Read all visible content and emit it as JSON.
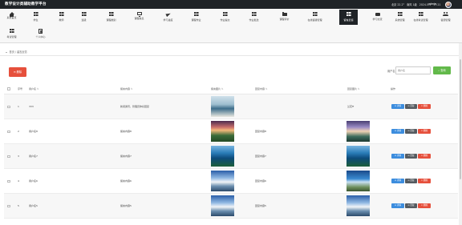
{
  "header": {
    "title": "教学设计类辅助教学平台",
    "date": "2024-5-1",
    "time": "17:21",
    "weather_a": "北京 22.2°",
    "weather_b": "南风 1级",
    "user": "admin"
  },
  "nav": {
    "items": [
      {
        "label": "系统首页",
        "icon": "home-icon"
      },
      {
        "label": "学生",
        "icon": "grid-icon"
      },
      {
        "label": "教师",
        "icon": "grid-icon"
      },
      {
        "label": "班级",
        "icon": "grid-icon"
      },
      {
        "label": "课程类别",
        "icon": "grid-icon"
      },
      {
        "label": "课程信息",
        "icon": "monitor-icon"
      },
      {
        "label": "学习进度",
        "icon": "plane-icon"
      },
      {
        "label": "课程作业",
        "icon": "grid-icon"
      },
      {
        "label": "作业提交",
        "icon": "grid-icon"
      },
      {
        "label": "作业批改",
        "icon": "grid-icon"
      },
      {
        "label": "课程评价",
        "icon": "folder-icon"
      },
      {
        "label": "在线答疑管理",
        "icon": "grid-icon"
      },
      {
        "label": "留言反馈",
        "icon": "grid-icon"
      },
      {
        "label": "学习交流",
        "icon": "chat-icon"
      },
      {
        "label": "系统管理",
        "icon": "grid-icon"
      },
      {
        "label": "在线考试管理",
        "icon": "grid-icon"
      },
      {
        "label": "答题管理",
        "icon": "users-icon"
      },
      {
        "label": "考试管理",
        "icon": "grid-icon"
      },
      {
        "label": "个人中心",
        "icon": "doc-icon"
      }
    ],
    "active_label": "留言反馈"
  },
  "breadcrumb": {
    "home": "首页",
    "sep": "/",
    "current": "留言反馈"
  },
  "toolbar": {
    "delete_label": "⊖ 删除",
    "search_label": "用户名",
    "search_placeholder": "用户名",
    "search_button": "⌕ 查询"
  },
  "table": {
    "columns": [
      "序号",
      "用户名",
      "留言内容",
      "留言图片",
      "回复内容",
      "回复图片",
      "操作"
    ],
    "rows": [
      {
        "index": "1",
        "username": "333",
        "content": "新闻通讯，管理员你好回复",
        "reply": "",
        "reply_image_text": "兰花ff"
      },
      {
        "index": "2",
        "username": "用户名8",
        "content": "留言内容8",
        "reply": "回复内容8",
        "reply_image_text": ""
      },
      {
        "index": "3",
        "username": "用户名7",
        "content": "留言内容7",
        "reply": "回复内容7",
        "reply_image_text": ""
      },
      {
        "index": "4",
        "username": "用户名6",
        "content": "留言内容6",
        "reply": "回复内容6",
        "reply_image_text": ""
      },
      {
        "index": "5",
        "username": "用户名5",
        "content": "留言内容5",
        "reply": "回复内容5",
        "reply_image_text": ""
      }
    ],
    "actions": {
      "edit": "⊙ 详情",
      "reply": "⊙ 回复",
      "delete": "× 删除"
    }
  }
}
